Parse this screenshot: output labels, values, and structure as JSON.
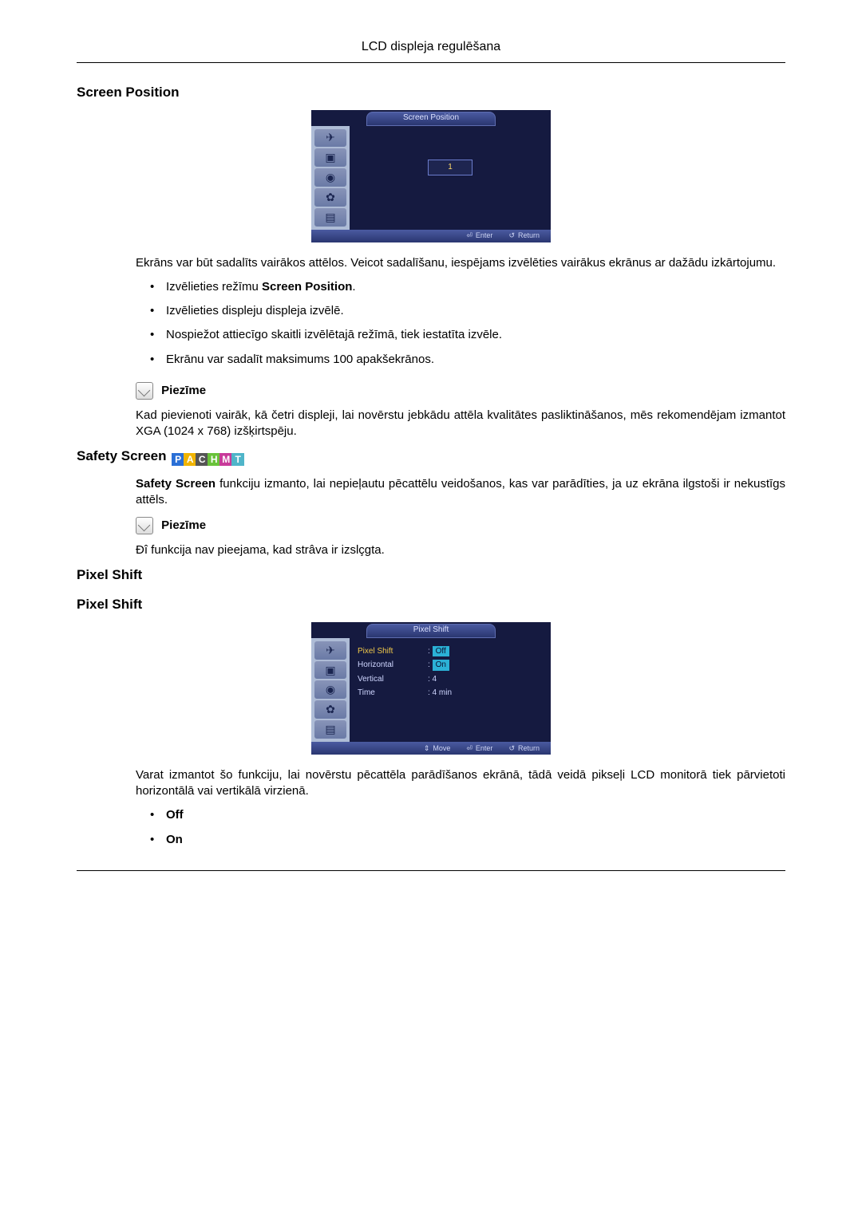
{
  "header": "LCD displeja regulēšana",
  "screen_position": {
    "heading": "Screen Position",
    "osd": {
      "title": "Screen Position",
      "value": "1",
      "footer_enter": "Enter",
      "footer_return": "Return"
    },
    "intro": "Ekrāns var būt sadalīts vairākos attēlos. Veicot sadalīšanu, iespējams izvēlēties vairākus ekrānus ar dažādu izkārtojumu.",
    "bullets": {
      "b1_pre": "Izvēlieties režīmu ",
      "b1_bold": "Screen Position",
      "b1_post": ".",
      "b2": "Izvēlieties displeju displeja izvēlē.",
      "b3": "Nospiežot attiecīgo skaitli izvēlētajā režīmā, tiek iestatīta izvēle.",
      "b4": "Ekrānu var sadalīt maksimums 100 apakšekrānos."
    },
    "note_label": "Piezīme",
    "note_text": "Kad pievienoti vairāk, kā četri displeji, lai novērstu jebkādu attēla kvalitātes pasliktināšanos, mēs rekomendējam izmantot XGA (1024 x 768) izšķirtspēju."
  },
  "safety_screen": {
    "heading": "Safety Screen",
    "badges": [
      "P",
      "A",
      "C",
      "H",
      "M",
      "T"
    ],
    "desc_bold": "Safety Screen",
    "desc_rest": " funkciju izmanto, lai nepieļautu pēcattēlu veidošanos, kas var parādīties, ja uz ekrāna ilgstoši ir nekustīgs attēls.",
    "note_label": "Piezīme",
    "note_text": "Ðî funkcija nav pieejama, kad strâva ir izslçgta."
  },
  "pixel_shift": {
    "heading1": "Pixel Shift",
    "heading2": "Pixel Shift",
    "osd": {
      "title": "Pixel Shift",
      "row_pixel_shift": "Pixel Shift",
      "row_horizontal": "Horizontal",
      "row_vertical": "Vertical",
      "row_time": "Time",
      "val_off": "Off",
      "val_on": "On",
      "val_vertical": ": 4",
      "val_time": ": 4 min",
      "footer_move": "Move",
      "footer_enter": "Enter",
      "footer_return": "Return"
    },
    "desc": "Varat izmantot šo funkciju, lai novērstu pēcattēla parādīšanos ekrānā, tādā veidā pikseļi LCD monitorā tiek pārvietoti horizontālā vai vertikālā virzienā.",
    "bullets": {
      "off": "Off",
      "on": "On"
    }
  }
}
